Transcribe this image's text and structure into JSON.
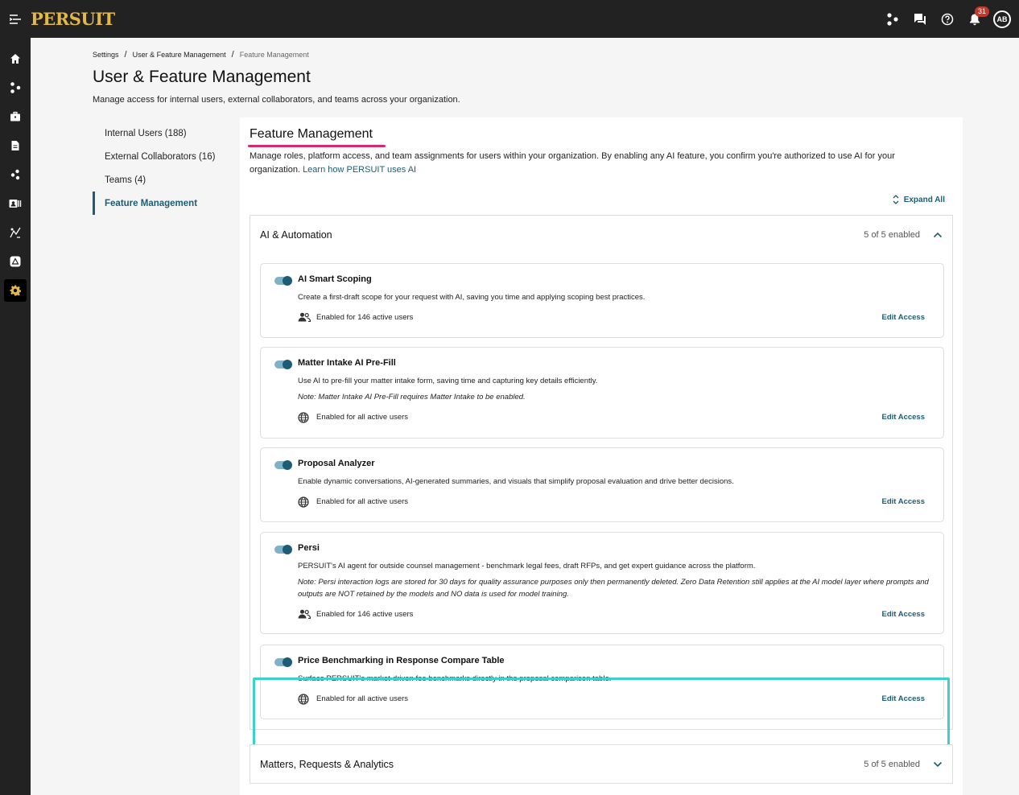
{
  "app": {
    "logo": "PERSUIT",
    "notifications_count": "31",
    "avatar_initials": "AB"
  },
  "breadcrumb": [
    "Settings",
    "User & Feature Management",
    "Feature Management"
  ],
  "page": {
    "title": "User & Feature Management",
    "description": "Manage access for internal users, external collaborators, and teams across your organization."
  },
  "subnav": [
    {
      "label": "Internal Users (188)"
    },
    {
      "label": "External Collaborators (16)"
    },
    {
      "label": "Teams (4)"
    },
    {
      "label": "Feature Management"
    }
  ],
  "panel": {
    "title": "Feature Management",
    "description": "Manage roles, platform access, and team assignments for users within your organization. By enabling any AI feature, you confirm you're authorized to use AI for your organization.",
    "learn_link": "Learn how PERSUIT uses AI",
    "expand_all": "Expand All"
  },
  "sections": [
    {
      "title": "AI & Automation",
      "count": "5 of 5 enabled"
    },
    {
      "title": "Matters, Requests & Analytics",
      "count": "5 of 5 enabled"
    }
  ],
  "features": [
    {
      "title": "AI Smart Scoping",
      "description": "Create a first-draft scope for your request with AI, saving you time and applying scoping best practices.",
      "note": "",
      "access": "Enabled for 146 active users",
      "access_icon": "users-icon",
      "edit": "Edit Access",
      "enabled": true
    },
    {
      "title": "Matter Intake AI Pre-Fill",
      "description": "Use AI to pre-fill your matter intake form, saving time and capturing key details efficiently.",
      "note": "Note: Matter Intake AI Pre-Fill requires Matter Intake to be enabled.",
      "access": "Enabled for all active users",
      "access_icon": "globe-icon",
      "edit": "Edit Access",
      "enabled": true
    },
    {
      "title": "Proposal Analyzer",
      "description": "Enable dynamic conversations, AI-generated summaries, and visuals that simplify proposal evaluation and drive better decisions.",
      "note": "",
      "access": "Enabled for all active users",
      "access_icon": "globe-icon",
      "edit": "Edit Access",
      "enabled": true
    },
    {
      "title": "Persi",
      "description": "PERSUIT's AI agent for outside counsel management - benchmark legal fees, draft RFPs, and get expert guidance across the platform.",
      "note": "Note: Persi interaction logs are stored for 30 days for quality assurance purposes only then permanently deleted. Zero Data Retention still applies at the AI model layer where prompts and outputs are NOT retained by the models and NO data is used for model training.",
      "access": "Enabled for 146 active users",
      "access_icon": "users-icon",
      "edit": "Edit Access",
      "enabled": true
    },
    {
      "title": "Price Benchmarking in Response Compare Table",
      "description": "Surface PERSUIT's market-driven fee benchmarks directly in the proposal comparison table.",
      "note": "",
      "access": "Enabled for all active users",
      "access_icon": "globe-icon",
      "edit": "Edit Access",
      "enabled": true
    }
  ],
  "colors": {
    "accent": "#1d5c74",
    "highlight": "#3ecfcf",
    "title_underline": "#d6286e",
    "logo": "#e2b84b"
  }
}
